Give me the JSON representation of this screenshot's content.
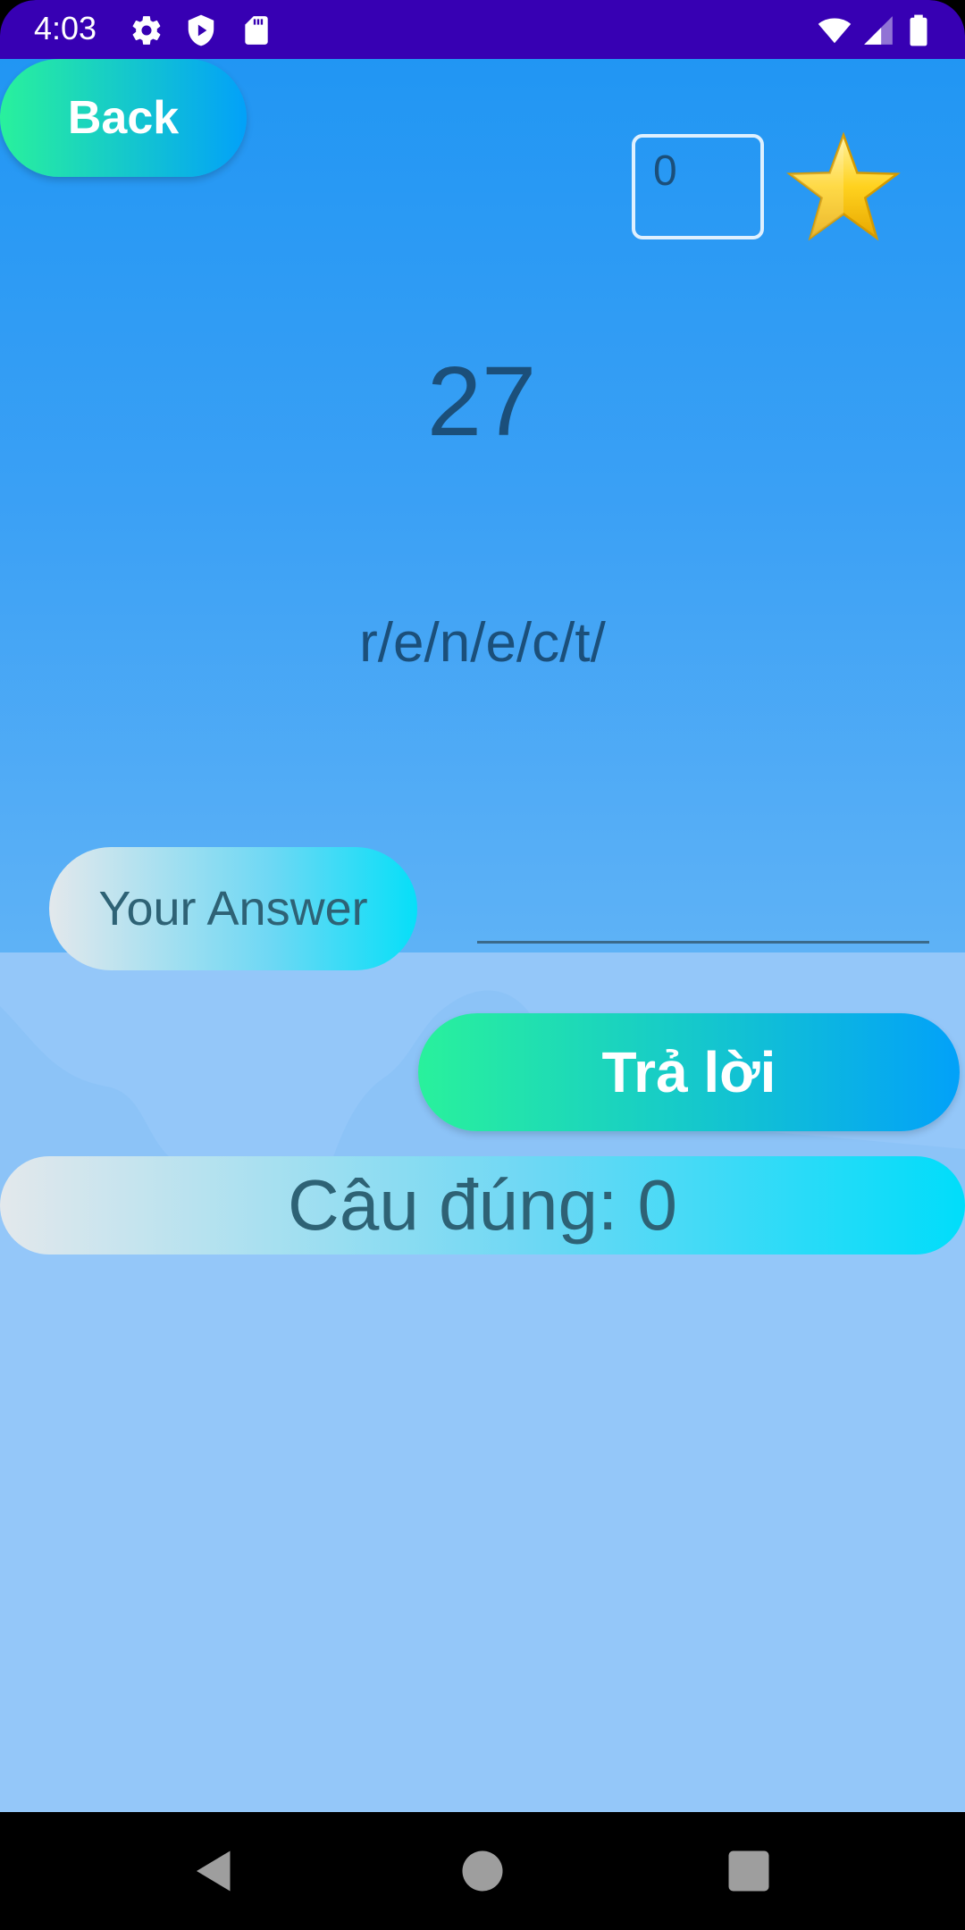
{
  "status_bar": {
    "time": "4:03",
    "icons": [
      "gear-icon",
      "shield-icon",
      "sd-card-icon",
      "wifi-icon",
      "signal-icon",
      "battery-icon"
    ]
  },
  "header": {
    "back_label": "Back",
    "score_value": "0"
  },
  "question": {
    "number": "27",
    "scrambled": "r/e/n/e/c/t/"
  },
  "answer": {
    "label": "Your Answer",
    "input_value": "",
    "input_placeholder": ""
  },
  "actions": {
    "submit_label": "Trả lời"
  },
  "result": {
    "correct_text": "Câu đúng: 0"
  },
  "colors": {
    "status_bar": "#3700b3",
    "primary_blue": "#2196f3",
    "text_dark": "#1b4f7a",
    "gradient_start": "#29f19c",
    "gradient_end": "#02a1f9"
  }
}
